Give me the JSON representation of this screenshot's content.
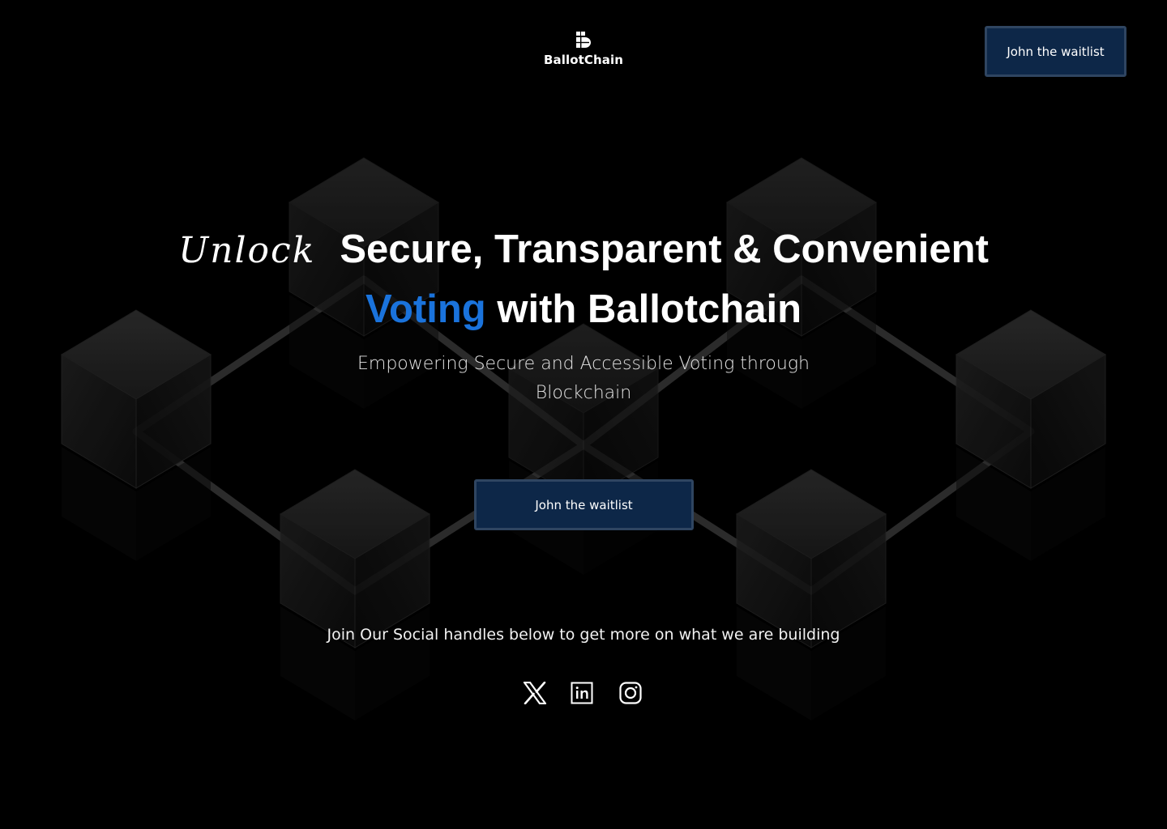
{
  "brand": {
    "name": "BallotChain"
  },
  "header": {
    "cta_label": "John the waitlist"
  },
  "hero": {
    "script_word": "Unlock",
    "headline_line1": "Secure, Transparent & Convenient",
    "headline_accent": "Voting",
    "headline_rest": " with Ballotchain",
    "subtitle": "Empowering Secure and Accessible Voting through Blockchain",
    "cta_label": "John the waitlist"
  },
  "social": {
    "prompt": "Join Our Social handles below to get more on what we are building",
    "icons": [
      "x-icon",
      "linkedin-icon",
      "instagram-icon"
    ]
  },
  "colors": {
    "background": "#000000",
    "accent": "#1a73dc",
    "button_fill": "#0d2748",
    "button_border": "#2f4561"
  }
}
